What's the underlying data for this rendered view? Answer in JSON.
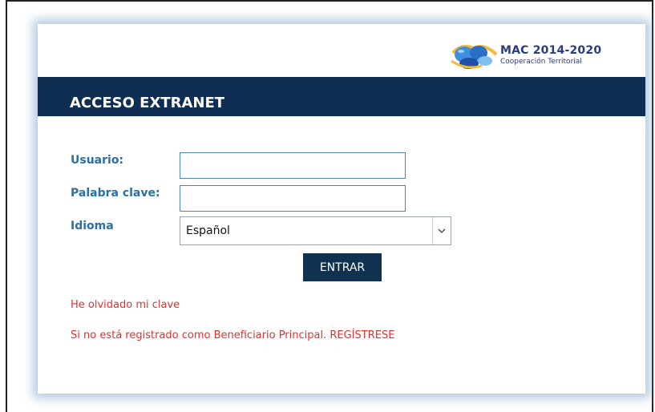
{
  "logo": {
    "title": "MAC 2014-2020",
    "subtitle": "Cooperación Territorial"
  },
  "header": {
    "title": "ACCESO EXTRANET"
  },
  "form": {
    "usuario_label": "Usuario:",
    "usuario_value": "",
    "clave_label": "Palabra clave:",
    "clave_value": "",
    "idioma_label": "Idioma",
    "idioma_selected": "Español",
    "submit_label": "ENTRAR"
  },
  "links": {
    "forgot": "He olvidado mi clave",
    "register": "Si no está registrado como Beneficiario Principal. REGÍSTRESE"
  },
  "colors": {
    "header_bg": "#0f2e52",
    "label": "#2a6fa8",
    "link": "#e0322d",
    "button_bg": "#10314f"
  }
}
